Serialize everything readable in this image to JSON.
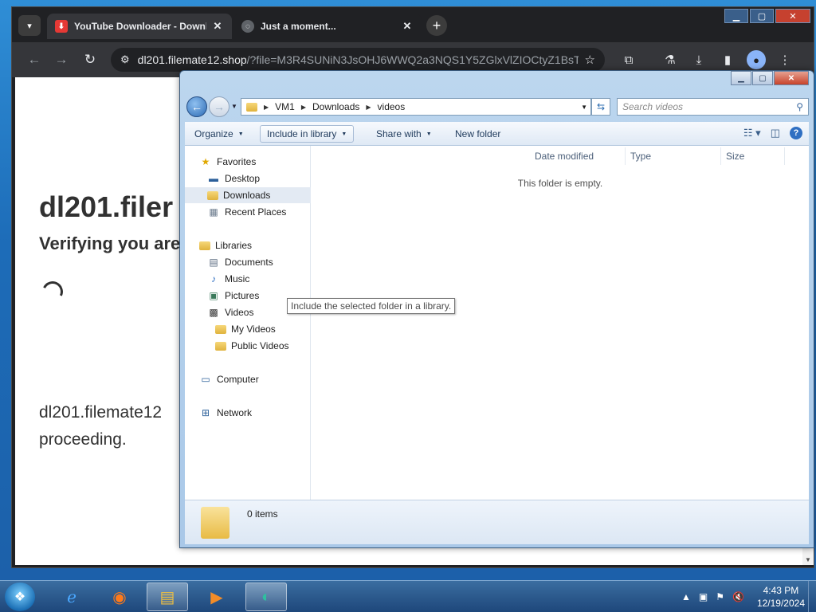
{
  "browser": {
    "tabs": [
      {
        "title": "YouTube Downloader - Download",
        "active": true
      },
      {
        "title": "Just a moment...",
        "active": false
      }
    ],
    "url_host": "dl201.filemate12.shop",
    "url_path": "/?file=M3R4SUNiN3JsOHJ6WWQ2a3NQS1Y5ZGlxVlZIOCtyZ1BsT...",
    "page": {
      "heading": "dl201.filer",
      "subheading": "Verifying you are",
      "paragraph": "dl201.filemate12 proceeding."
    },
    "icons": {
      "tab_search": "chevron-down-icon",
      "close": "close-icon",
      "new_tab": "plus-icon",
      "back": "arrow-left-icon",
      "forward": "arrow-right-icon",
      "reload": "reload-icon",
      "site_info": "tune-icon",
      "bookmark": "star-icon",
      "extensions": "puzzle-icon",
      "labs": "flask-icon",
      "downloads": "download-icon",
      "side_panel": "side-panel-icon",
      "profile": "profile-icon",
      "menu": "kebab-menu-icon"
    }
  },
  "explorer": {
    "breadcrumb": [
      "VM1",
      "Downloads",
      "videos"
    ],
    "search_placeholder": "Search videos",
    "commands": {
      "organize": "Organize",
      "include_in_library": "Include in library",
      "share_with": "Share with",
      "new_folder": "New folder"
    },
    "tooltip": "Include the selected folder in a library.",
    "nav": {
      "favorites": "Favorites",
      "desktop": "Desktop",
      "downloads": "Downloads",
      "recent_places": "Recent Places",
      "libraries": "Libraries",
      "documents": "Documents",
      "music": "Music",
      "pictures": "Pictures",
      "videos": "Videos",
      "my_videos": "My Videos",
      "public_videos": "Public Videos",
      "computer": "Computer",
      "network": "Network"
    },
    "columns": {
      "date_modified": "Date modified",
      "type": "Type",
      "size": "Size"
    },
    "empty_message": "This folder is empty.",
    "item_count": "0 items"
  },
  "taskbar": {
    "time": "4:43 PM",
    "date": "12/19/2024"
  },
  "colors": {
    "chrome_dark": "#202124",
    "chrome_toolbar": "#35363a",
    "explorer_frame": "#bcd6ee",
    "taskbar": "#1e4678",
    "close_red": "#c6412f"
  }
}
